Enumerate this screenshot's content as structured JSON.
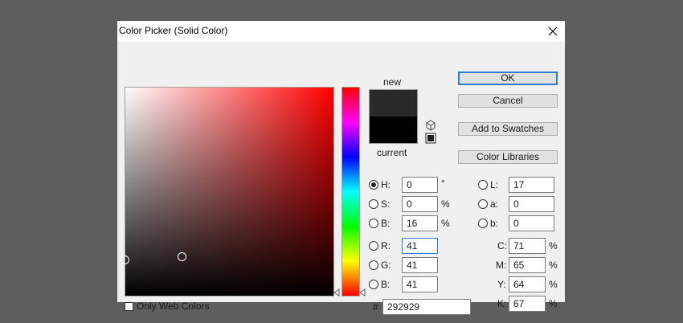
{
  "window": {
    "title": "Color Picker (Solid Color)"
  },
  "buttons": {
    "ok": "OK",
    "cancel": "Cancel",
    "add_swatches": "Add to Swatches",
    "color_libraries": "Color Libraries"
  },
  "swatch": {
    "new_label": "new",
    "current_label": "current",
    "new_color": "#292929",
    "current_color": "#000000"
  },
  "only_web_colors": {
    "label": "Only Web Colors",
    "checked": false
  },
  "hsb": {
    "h": {
      "label": "H:",
      "value": "0",
      "unit": "°",
      "selected": true
    },
    "s": {
      "label": "S:",
      "value": "0",
      "unit": "%",
      "selected": false
    },
    "b": {
      "label": "B:",
      "value": "16",
      "unit": "%",
      "selected": false
    }
  },
  "rgb": {
    "r": {
      "label": "R:",
      "value": "41"
    },
    "g": {
      "label": "G:",
      "value": "41"
    },
    "b": {
      "label": "B:",
      "value": "41"
    }
  },
  "lab": {
    "l": {
      "label": "L:",
      "value": "17"
    },
    "a": {
      "label": "a:",
      "value": "0"
    },
    "b": {
      "label": "b:",
      "value": "0"
    }
  },
  "cmyk": {
    "c": {
      "label": "C:",
      "value": "71",
      "unit": "%"
    },
    "m": {
      "label": "M:",
      "value": "65",
      "unit": "%"
    },
    "y": {
      "label": "Y:",
      "value": "64",
      "unit": "%"
    },
    "k": {
      "label": "K:",
      "value": "67",
      "unit": "%"
    }
  },
  "hex": {
    "label": "#",
    "value": "292929"
  },
  "colors": {
    "focus_blue": "#2b7bd6",
    "hue_base": "#ff0000"
  }
}
